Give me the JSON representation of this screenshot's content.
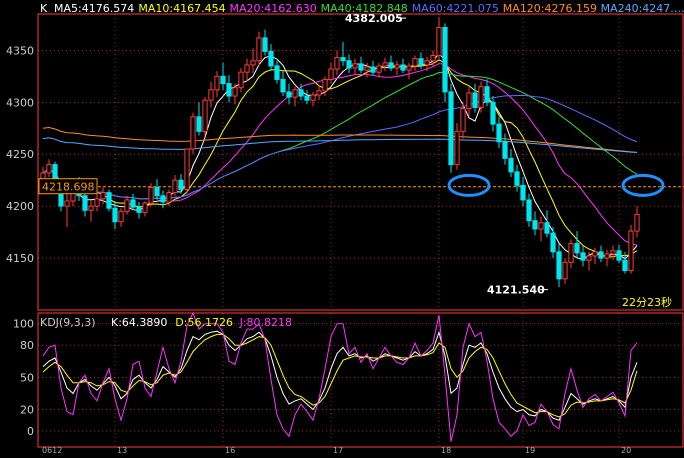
{
  "chart_data": [
    {
      "type": "candlestick",
      "panel": "price",
      "prefix": "K",
      "ma_legend": [
        {
          "label": "MA5:4176.574",
          "color": "#ffffff"
        },
        {
          "label": "MA10:4167.454",
          "color": "#ffff00"
        },
        {
          "label": "MA20:4162.630",
          "color": "#ff33ff"
        },
        {
          "label": "MA40:4182.848",
          "color": "#33dd33"
        },
        {
          "label": "MA60:4221.075",
          "color": "#5a6cff"
        },
        {
          "label": "MA120:4276.159",
          "color": "#ff8c2a"
        },
        {
          "label": "MA240:4247.…",
          "color": "#55aaff"
        }
      ],
      "ylim": [
        4100,
        4385
      ],
      "yticks": [
        4150,
        4200,
        4250,
        4300,
        4350
      ],
      "reference_line": {
        "value": 4218.698,
        "label": "4218.698",
        "color": "#ff9a00"
      },
      "annotations": {
        "high": {
          "value": 4382.005,
          "label": "4382.005"
        },
        "low": {
          "value": 4121.54,
          "label": "4121.540"
        },
        "countdown": "22分23秒"
      },
      "x_labels": [
        "0612",
        "13",
        "16",
        "17",
        "18",
        "19",
        "20"
      ],
      "markers": [
        {
          "near_label": "18",
          "value": 4220,
          "color": "#1e90ff"
        },
        {
          "near_label": "20",
          "value": 4220,
          "color": "#1e90ff"
        }
      ],
      "candles": [
        [
          4225,
          4238,
          4215,
          4232
        ],
        [
          4232,
          4245,
          4228,
          4240
        ],
        [
          4240,
          4243,
          4218,
          4222
        ],
        [
          4222,
          4226,
          4195,
          4200
        ],
        [
          4200,
          4212,
          4180,
          4205
        ],
        [
          4205,
          4225,
          4200,
          4220
        ],
        [
          4220,
          4228,
          4205,
          4210
        ],
        [
          4210,
          4215,
          4190,
          4196
        ],
        [
          4196,
          4206,
          4185,
          4200
        ],
        [
          4200,
          4212,
          4195,
          4207
        ],
        [
          4207,
          4218,
          4202,
          4213
        ],
        [
          4213,
          4216,
          4195,
          4198
        ],
        [
          4198,
          4205,
          4178,
          4185
        ],
        [
          4185,
          4198,
          4180,
          4195
        ],
        [
          4195,
          4210,
          4192,
          4206
        ],
        [
          4206,
          4212,
          4196,
          4199
        ],
        [
          4199,
          4204,
          4188,
          4194
        ],
        [
          4194,
          4205,
          4190,
          4203
        ],
        [
          4203,
          4222,
          4200,
          4218
        ],
        [
          4218,
          4226,
          4206,
          4210
        ],
        [
          4210,
          4215,
          4198,
          4204
        ],
        [
          4204,
          4216,
          4200,
          4213
        ],
        [
          4213,
          4230,
          4210,
          4225
        ],
        [
          4225,
          4231,
          4212,
          4216
        ],
        [
          4216,
          4240,
          4212,
          4255
        ],
        [
          4255,
          4290,
          4250,
          4286
        ],
        [
          4286,
          4300,
          4268,
          4272
        ],
        [
          4272,
          4305,
          4268,
          4302
        ],
        [
          4302,
          4320,
          4295,
          4312
        ],
        [
          4312,
          4330,
          4305,
          4325
        ],
        [
          4325,
          4338,
          4312,
          4318
        ],
        [
          4318,
          4326,
          4300,
          4306
        ],
        [
          4306,
          4318,
          4298,
          4314
        ],
        [
          4314,
          4333,
          4310,
          4329
        ],
        [
          4329,
          4342,
          4320,
          4336
        ],
        [
          4336,
          4352,
          4328,
          4340
        ],
        [
          4340,
          4368,
          4335,
          4362
        ],
        [
          4362,
          4370,
          4345,
          4349
        ],
        [
          4349,
          4356,
          4330,
          4335
        ],
        [
          4335,
          4340,
          4318,
          4322
        ],
        [
          4322,
          4330,
          4306,
          4310
        ],
        [
          4310,
          4318,
          4298,
          4305
        ],
        [
          4305,
          4315,
          4296,
          4312
        ],
        [
          4312,
          4318,
          4302,
          4306
        ],
        [
          4306,
          4312,
          4298,
          4302
        ],
        [
          4302,
          4310,
          4296,
          4307
        ],
        [
          4307,
          4316,
          4302,
          4311
        ],
        [
          4311,
          4325,
          4306,
          4322
        ],
        [
          4322,
          4338,
          4318,
          4332
        ],
        [
          4332,
          4350,
          4326,
          4343
        ],
        [
          4343,
          4358,
          4335,
          4340
        ],
        [
          4340,
          4346,
          4328,
          4333
        ],
        [
          4333,
          4342,
          4326,
          4337
        ],
        [
          4337,
          4344,
          4328,
          4331
        ],
        [
          4331,
          4338,
          4324,
          4334
        ],
        [
          4334,
          4340,
          4326,
          4329
        ],
        [
          4329,
          4338,
          4324,
          4335
        ],
        [
          4335,
          4343,
          4330,
          4338
        ],
        [
          4338,
          4345,
          4330,
          4333
        ],
        [
          4333,
          4340,
          4326,
          4336
        ],
        [
          4336,
          4342,
          4328,
          4331
        ],
        [
          4331,
          4338,
          4322,
          4335
        ],
        [
          4335,
          4345,
          4330,
          4342
        ],
        [
          4342,
          4348,
          4332,
          4336
        ],
        [
          4336,
          4344,
          4330,
          4340
        ],
        [
          4340,
          4350,
          4334,
          4345
        ],
        [
          4345,
          4382,
          4340,
          4372
        ],
        [
          4372,
          4376,
          4300,
          4310
        ],
        [
          4310,
          4318,
          4232,
          4240
        ],
        [
          4240,
          4280,
          4235,
          4272
        ],
        [
          4272,
          4300,
          4265,
          4294
        ],
        [
          4294,
          4316,
          4286,
          4309
        ],
        [
          4309,
          4318,
          4290,
          4295
        ],
        [
          4295,
          4320,
          4290,
          4315
        ],
        [
          4315,
          4322,
          4296,
          4300
        ],
        [
          4300,
          4306,
          4272,
          4279
        ],
        [
          4279,
          4286,
          4256,
          4262
        ],
        [
          4262,
          4270,
          4240,
          4246
        ],
        [
          4246,
          4255,
          4228,
          4233
        ],
        [
          4233,
          4240,
          4214,
          4220
        ],
        [
          4220,
          4228,
          4200,
          4206
        ],
        [
          4206,
          4212,
          4180,
          4186
        ],
        [
          4186,
          4195,
          4172,
          4178
        ],
        [
          4178,
          4190,
          4166,
          4184
        ],
        [
          4184,
          4196,
          4170,
          4174
        ],
        [
          4174,
          4180,
          4150,
          4156
        ],
        [
          4156,
          4164,
          4122,
          4130
        ],
        [
          4130,
          4150,
          4125,
          4146
        ],
        [
          4146,
          4168,
          4140,
          4164
        ],
        [
          4164,
          4176,
          4150,
          4155
        ],
        [
          4155,
          4162,
          4142,
          4148
        ],
        [
          4148,
          4156,
          4138,
          4152
        ],
        [
          4152,
          4160,
          4144,
          4156
        ],
        [
          4156,
          4162,
          4146,
          4150
        ],
        [
          4150,
          4158,
          4142,
          4154
        ],
        [
          4154,
          4162,
          4148,
          4157
        ],
        [
          4157,
          4163,
          4145,
          4148
        ],
        [
          4148,
          4156,
          4135,
          4138
        ],
        [
          4138,
          4182,
          4135,
          4176
        ],
        [
          4176,
          4200,
          4170,
          4192
        ]
      ]
    },
    {
      "type": "line",
      "panel": "kdj",
      "legend": [
        {
          "label": "KDJ(9,3,3)",
          "color": "#cccccc"
        },
        {
          "label": "K:64.3890",
          "color": "#ffffff"
        },
        {
          "label": "D:56.1726",
          "color": "#ffff00"
        },
        {
          "label": "J:80.8218",
          "color": "#ff33ff"
        }
      ],
      "ylim": [
        -15,
        110
      ],
      "yticks": [
        0,
        20,
        50,
        80,
        100
      ],
      "series": [
        {
          "name": "K",
          "color": "#ffffff",
          "values": [
            60,
            65,
            68,
            55,
            40,
            35,
            45,
            48,
            42,
            38,
            44,
            50,
            42,
            30,
            35,
            48,
            52,
            45,
            40,
            48,
            60,
            55,
            50,
            58,
            75,
            88,
            85,
            90,
            92,
            93,
            90,
            80,
            75,
            80,
            86,
            88,
            92,
            86,
            70,
            50,
            35,
            25,
            28,
            30,
            25,
            20,
            28,
            40,
            58,
            72,
            78,
            70,
            72,
            68,
            70,
            65,
            68,
            72,
            70,
            68,
            66,
            68,
            74,
            70,
            72,
            76,
            92,
            70,
            35,
            40,
            62,
            80,
            78,
            82,
            72,
            55,
            40,
            30,
            22,
            18,
            20,
            15,
            14,
            20,
            18,
            12,
            10,
            22,
            35,
            30,
            25,
            28,
            30,
            28,
            30,
            32,
            28,
            22,
            50,
            64
          ]
        },
        {
          "name": "D",
          "color": "#ffff00",
          "values": [
            55,
            60,
            64,
            60,
            52,
            45,
            45,
            46,
            45,
            42,
            43,
            46,
            45,
            38,
            36,
            42,
            47,
            46,
            43,
            45,
            52,
            54,
            52,
            55,
            64,
            74,
            80,
            85,
            88,
            90,
            90,
            86,
            80,
            80,
            82,
            85,
            88,
            87,
            80,
            66,
            52,
            40,
            34,
            32,
            28,
            24,
            26,
            32,
            44,
            56,
            66,
            68,
            70,
            69,
            69,
            68,
            68,
            70,
            70,
            69,
            68,
            68,
            70,
            70,
            71,
            73,
            82,
            78,
            58,
            50,
            56,
            68,
            74,
            78,
            76,
            68,
            56,
            44,
            34,
            26,
            23,
            20,
            17,
            18,
            18,
            15,
            13,
            16,
            24,
            27,
            26,
            27,
            28,
            28,
            29,
            30,
            29,
            26,
            38,
            56
          ]
        },
        {
          "name": "J",
          "color": "#ff33ff",
          "values": [
            70,
            78,
            80,
            40,
            18,
            15,
            45,
            52,
            35,
            28,
            45,
            58,
            30,
            10,
            30,
            62,
            65,
            40,
            32,
            55,
            78,
            58,
            45,
            65,
            98,
            110,
            95,
            100,
            100,
            100,
            92,
            65,
            62,
            82,
            95,
            95,
            100,
            85,
            48,
            15,
            2,
            -5,
            15,
            25,
            18,
            10,
            30,
            58,
            88,
            100,
            100,
            72,
            78,
            64,
            72,
            58,
            68,
            78,
            70,
            64,
            62,
            68,
            82,
            70,
            75,
            82,
            108,
            52,
            -10,
            15,
            78,
            100,
            88,
            92,
            65,
            30,
            8,
            2,
            -5,
            0,
            15,
            5,
            8,
            25,
            18,
            6,
            2,
            35,
            58,
            38,
            22,
            30,
            34,
            28,
            32,
            36,
            26,
            14,
            75,
            82
          ]
        }
      ]
    }
  ]
}
